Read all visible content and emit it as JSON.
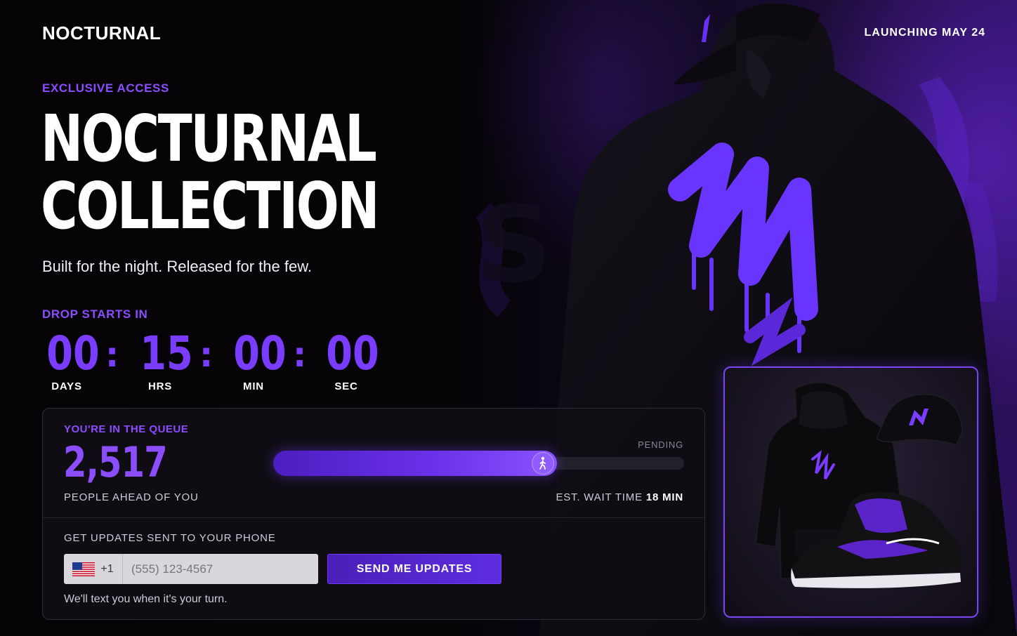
{
  "header": {
    "brand": "NOCTURNAL",
    "launch_text": "LAUNCHING MAY 24"
  },
  "hero": {
    "eyebrow": "EXCLUSIVE ACCESS",
    "title_line1": "NOCTURNAL",
    "title_line2": "COLLECTION",
    "tagline": "Built for the night. Released for the few."
  },
  "countdown": {
    "label": "DROP STARTS IN",
    "units": [
      {
        "value": "00",
        "label": "DAYS"
      },
      {
        "value": "15",
        "label": "HRS"
      },
      {
        "value": "00",
        "label": "MIN"
      },
      {
        "value": "00",
        "label": "SEC"
      }
    ],
    "separator": ":"
  },
  "queue": {
    "title": "YOU'RE IN THE QUEUE",
    "count": "2,517",
    "count_sub": "PEOPLE AHEAD OF YOU",
    "status": "PENDING",
    "progress_fraction": 0.69,
    "wait_label": "EST. WAIT TIME",
    "wait_value": "18 MIN"
  },
  "phone": {
    "label": "GET UPDATES SENT TO YOUR PHONE",
    "country_code": "+1",
    "placeholder": "(555) 123-4567",
    "button_label": "SEND ME UPDATES",
    "note": "We'll text you when it's your turn."
  },
  "colors": {
    "accent": "#8c4dff",
    "countdown": "#7a3cff",
    "background": "#060408"
  },
  "icons": {
    "progress_knob": "walking-person-icon",
    "country_flag": "us-flag-icon"
  }
}
